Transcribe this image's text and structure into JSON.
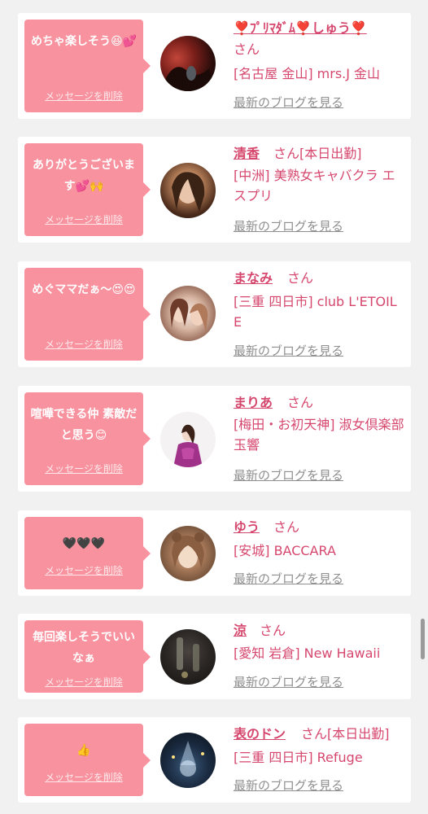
{
  "common": {
    "delete_label": "メッセージを削除",
    "blog_label": "最新のブログを見る",
    "san_label": "さん"
  },
  "colors": {
    "bubble": "#f7929e",
    "name": "#d6476e",
    "link_gray": "#8f8f8f",
    "background": "#f1f1f1"
  },
  "cards": [
    {
      "message": "めちゃ楽しそう😆💕",
      "name": "❣️ﾌﾟﾘﾏﾀﾞﾑ❣️しゅう❣️",
      "san_suffix": "さん",
      "shop": "[名古屋 金山] mrs.J 金山"
    },
    {
      "message": "ありがとうございます💕🙌",
      "name": "清香",
      "san_suffix": "さん[本日出勤]",
      "shop": "[中洲] 美熟女キャバクラ エスプリ"
    },
    {
      "message": "めぐママだぁ〜😍😍",
      "name": "まなみ",
      "san_suffix": "さん",
      "shop": "[三重 四日市] club L'ETOILE"
    },
    {
      "message": "喧嘩できる仲 素敵だと思う😊",
      "name": "まりあ",
      "san_suffix": "さん",
      "shop": "[梅田・お初天神] 淑女倶楽部 玉響"
    },
    {
      "message": "🖤🖤🖤",
      "name": "ゆう",
      "san_suffix": "さん",
      "shop": "[安城] BACCARA"
    },
    {
      "message": "毎回楽しそうでいいなぁ",
      "name": "涼",
      "san_suffix": "さん",
      "shop": "[愛知 岩倉] New Hawaii"
    },
    {
      "message": "👍",
      "name": "表のドン",
      "san_suffix": "さん[本日出勤]",
      "shop": "[三重 四日市] Refuge"
    }
  ]
}
